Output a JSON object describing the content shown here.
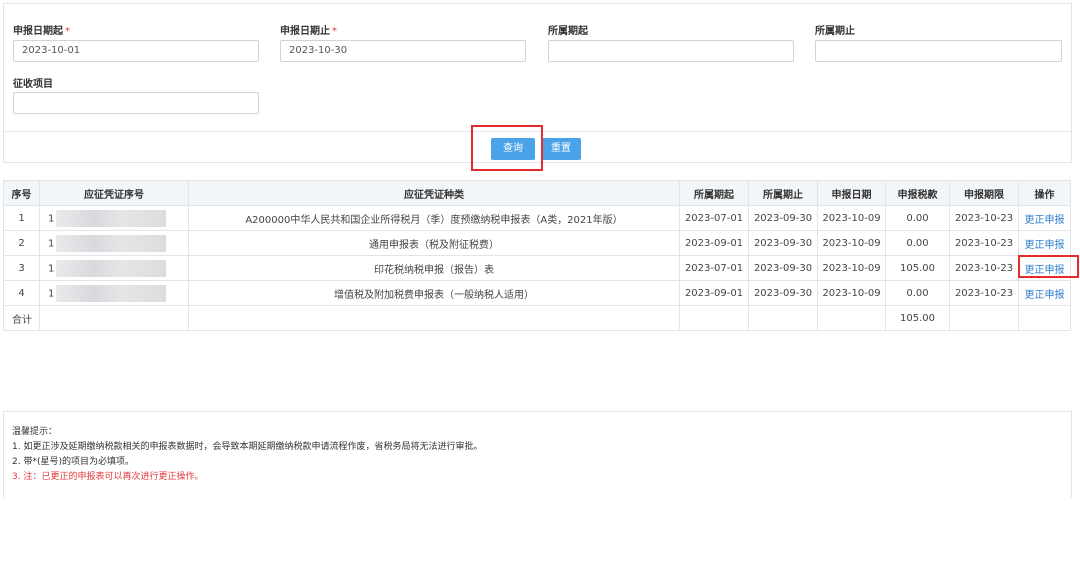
{
  "form": {
    "fields": [
      {
        "label": "申报日期起",
        "required": true,
        "value": "2023-10-01",
        "placeholder": ""
      },
      {
        "label": "申报日期止",
        "required": true,
        "value": "2023-10-30",
        "placeholder": ""
      },
      {
        "label": "所属期起",
        "required": false,
        "value": "",
        "placeholder": ""
      },
      {
        "label": "所属期止",
        "required": false,
        "value": "",
        "placeholder": ""
      },
      {
        "label": "征收项目",
        "required": false,
        "value": "",
        "placeholder": ""
      }
    ],
    "required_mark": "*",
    "query_label": "查询",
    "reset_label": "重置"
  },
  "table": {
    "columns": [
      "序号",
      "应征凭证序号",
      "应征凭证种类",
      "所属期起",
      "所属期止",
      "申报日期",
      "申报税款",
      "申报期限",
      "操作"
    ],
    "rows": [
      {
        "index": "1",
        "voucher_no": "1",
        "type": "A200000中华人民共和国企业所得税月（季）度预缴纳税申报表（A类，2021年版）",
        "period_start": "2023-07-01",
        "period_end": "2023-09-30",
        "declare_date": "2023-10-09",
        "tax": "0.00",
        "deadline": "2023-10-23",
        "action": "更正申报"
      },
      {
        "index": "2",
        "voucher_no": "1",
        "type": "通用申报表（税及附征税费）",
        "period_start": "2023-09-01",
        "period_end": "2023-09-30",
        "declare_date": "2023-10-09",
        "tax": "0.00",
        "deadline": "2023-10-23",
        "action": "更正申报"
      },
      {
        "index": "3",
        "voucher_no": "1",
        "type": "印花税纳税申报（报告）表",
        "period_start": "2023-07-01",
        "period_end": "2023-09-30",
        "declare_date": "2023-10-09",
        "tax": "105.00",
        "deadline": "2023-10-23",
        "action": "更正申报"
      },
      {
        "index": "4",
        "voucher_no": "1",
        "type": "增值税及附加税费申报表（一般纳税人适用）",
        "period_start": "2023-09-01",
        "period_end": "2023-09-30",
        "declare_date": "2023-10-09",
        "tax": "0.00",
        "deadline": "2023-10-23",
        "action": "更正申报"
      }
    ],
    "total_label": "合计",
    "total_tax": "105.00"
  },
  "tips": {
    "title": "温馨提示：",
    "items": [
      "1. 如更正涉及延期缴纳税款相关的申报表数据时，会导致本期延期缴纳税款申请流程作废，省税务局将无法进行审批。",
      "2. 带*(星号)的项目为必填项。",
      "3. 注：已更正的申报表可以再次进行更正操作。"
    ]
  },
  "colors": {
    "accent": "#4aa3e8",
    "link": "#2f7fd0",
    "highlight": "#e52b2b",
    "required": "#e5383b"
  }
}
